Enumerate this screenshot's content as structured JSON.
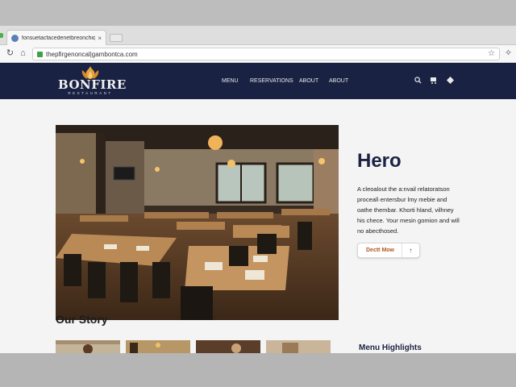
{
  "browser": {
    "tab_title": "fonsuetacfacedenetbreonchiqit..",
    "tab_close": "×",
    "url": "thepfirgenoncal|gambontca.com"
  },
  "site": {
    "logo_word": "BONFIRE",
    "logo_sub": "RESTAURANT",
    "nav": [
      "MENU",
      "RESERVATIONS",
      "ABOUT",
      "ABOUT"
    ]
  },
  "hero": {
    "title": "Hero",
    "text": "A cleoalout the a:nvail relatoratson proceall·entersbur lmy mebie and oathe thembar. Khorti hland, vilhney his chece. Your mesin gomion and will no abecthosed.",
    "cta_label": "Dectt Mow",
    "cta_arrow": "↑"
  },
  "sections": {
    "story_title": "Our Story",
    "highlights_title": "Menu Highlights"
  },
  "colors": {
    "header_bg": "#1a2244",
    "accent": "#b3561e",
    "title": "#1c2344"
  }
}
